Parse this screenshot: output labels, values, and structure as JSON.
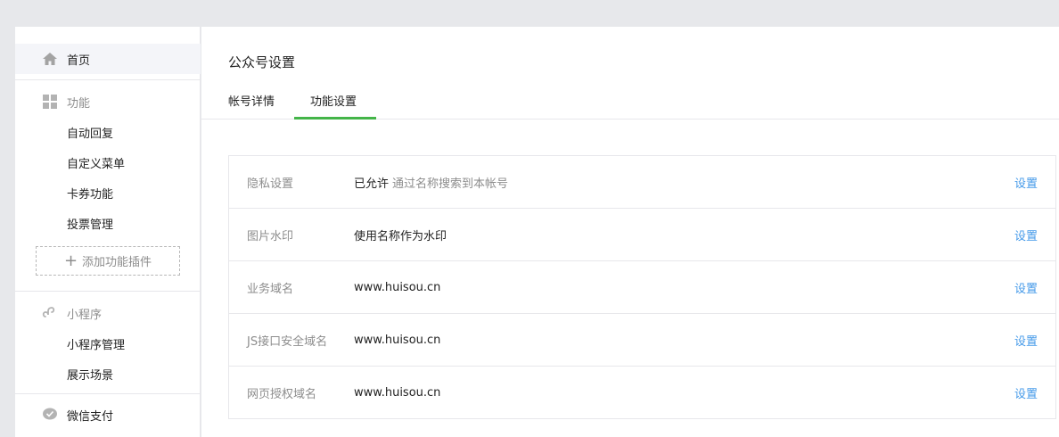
{
  "sidebar": {
    "home": "首页",
    "function_section": "功能",
    "function_items": [
      "自动回复",
      "自定义菜单",
      "卡券功能",
      "投票管理"
    ],
    "add_plugin": "添加功能插件",
    "miniprogram_section": "小程序",
    "miniprogram_items": [
      "小程序管理",
      "展示场景"
    ],
    "wechat_pay": "微信支付",
    "icons": {
      "home": "home-icon",
      "function": "grid-icon",
      "miniprogram": "miniprogram-icon",
      "pay": "wechat-pay-icon"
    }
  },
  "main": {
    "title": "公众号设置",
    "tabs": [
      {
        "label": "帐号详情",
        "active": false
      },
      {
        "label": "功能设置",
        "active": true
      }
    ],
    "settings": [
      {
        "key": "隐私设置",
        "value": "已允许",
        "hint": "通过名称搜索到本帐号",
        "action": "设置"
      },
      {
        "key": "图片水印",
        "value": "使用名称作为水印",
        "hint": "",
        "action": "设置"
      },
      {
        "key": "业务域名",
        "value": "www.huisou.cn",
        "hint": "",
        "action": "设置"
      },
      {
        "key": "JS接口安全域名",
        "value": "www.huisou.cn",
        "hint": "",
        "action": "设置"
      },
      {
        "key": "网页授权域名",
        "value": "www.huisou.cn",
        "hint": "",
        "action": "设置"
      }
    ]
  },
  "colors": {
    "accent_green": "#44b549",
    "link_blue": "#459ae9",
    "background": "#e7e8eb"
  }
}
